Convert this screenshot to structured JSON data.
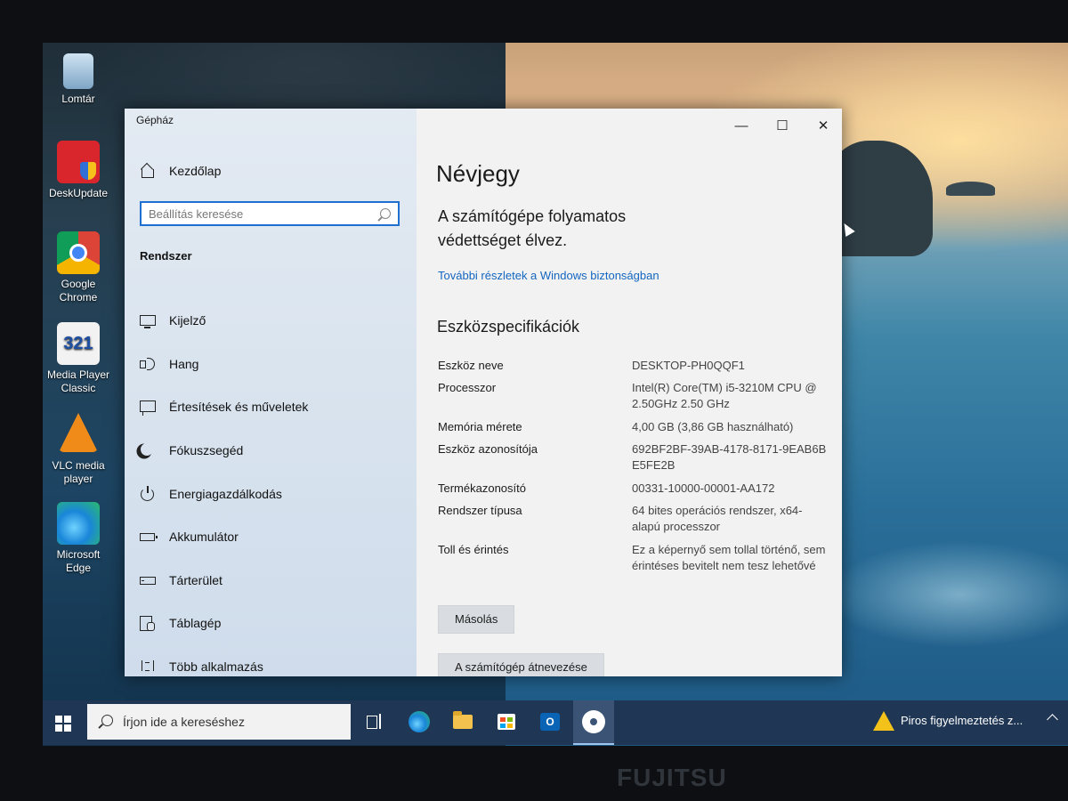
{
  "desktop": {
    "icons": [
      {
        "label": "Lomtár",
        "icon": "recycle-bin-icon"
      },
      {
        "label": "DeskUpdate",
        "icon": "deskupdate-icon"
      },
      {
        "label": "Google Chrome",
        "icon": "chrome-icon"
      },
      {
        "label": "Media Player Classic",
        "icon": "media-player-icon"
      },
      {
        "label": "VLC media player",
        "icon": "vlc-icon"
      },
      {
        "label": "Microsoft Edge",
        "icon": "edge-icon"
      }
    ]
  },
  "window": {
    "app_title": "Gépház",
    "controls": {
      "minimize": "—",
      "maximize": "☐",
      "close": "✕"
    },
    "sidebar": {
      "home_label": "Kezdőlap",
      "search_placeholder": "Beállítás keresése",
      "section_title": "Rendszer",
      "items": [
        {
          "label": "Kijelző",
          "icon": "monitor-icon"
        },
        {
          "label": "Hang",
          "icon": "speaker-icon"
        },
        {
          "label": "Értesítések és műveletek",
          "icon": "notification-icon"
        },
        {
          "label": "Fókuszsegéd",
          "icon": "moon-icon"
        },
        {
          "label": "Energiagazdálkodás",
          "icon": "power-icon"
        },
        {
          "label": "Akkumulátor",
          "icon": "battery-icon"
        },
        {
          "label": "Tárterület",
          "icon": "storage-icon"
        },
        {
          "label": "Táblagép",
          "icon": "tablet-icon"
        },
        {
          "label": "Több alkalmazás",
          "icon": "multitasking-icon"
        }
      ]
    },
    "content": {
      "page_title": "Névjegy",
      "security_text": "A számítógépe folyamatos védettséget élvez.",
      "security_link": "További részletek a Windows biztonságban",
      "specs_title": "Eszközspecifikációk",
      "specs": [
        {
          "label": "Eszköz neve",
          "value": "DESKTOP-PH0QQF1"
        },
        {
          "label": "Processzor",
          "value": "Intel(R) Core(TM) i5-3210M CPU @ 2.50GHz   2.50 GHz"
        },
        {
          "label": "Memória mérete",
          "value": "4,00 GB (3,86 GB használható)"
        },
        {
          "label": "Eszköz azonosítója",
          "value": "692BF2BF-39AB-4178-8171-9EAB6BE5FE2B"
        },
        {
          "label": "Termékazonosító",
          "value": "00331-10000-00001-AA172"
        },
        {
          "label": "Rendszer típusa",
          "value": "64 bites operációs rendszer, x64-alapú processzor"
        },
        {
          "label": "Toll és érintés",
          "value": "Ez a képernyő sem tollal történő, sem érintéses bevitelt nem tesz lehetővé"
        }
      ],
      "copy_button": "Másolás",
      "rename_button": "A számítógép átnevezése"
    }
  },
  "taskbar": {
    "search_placeholder": "Írjon ide a kereséshez",
    "outlook_letter": "O",
    "notification_text": "Piros figyelmeztetés z...",
    "colors": {
      "taskbar": "#1f3654",
      "accent": "#1f6fd0",
      "active_app": "#3b5375"
    }
  },
  "bezel": {
    "brand": "FUJITSU"
  }
}
